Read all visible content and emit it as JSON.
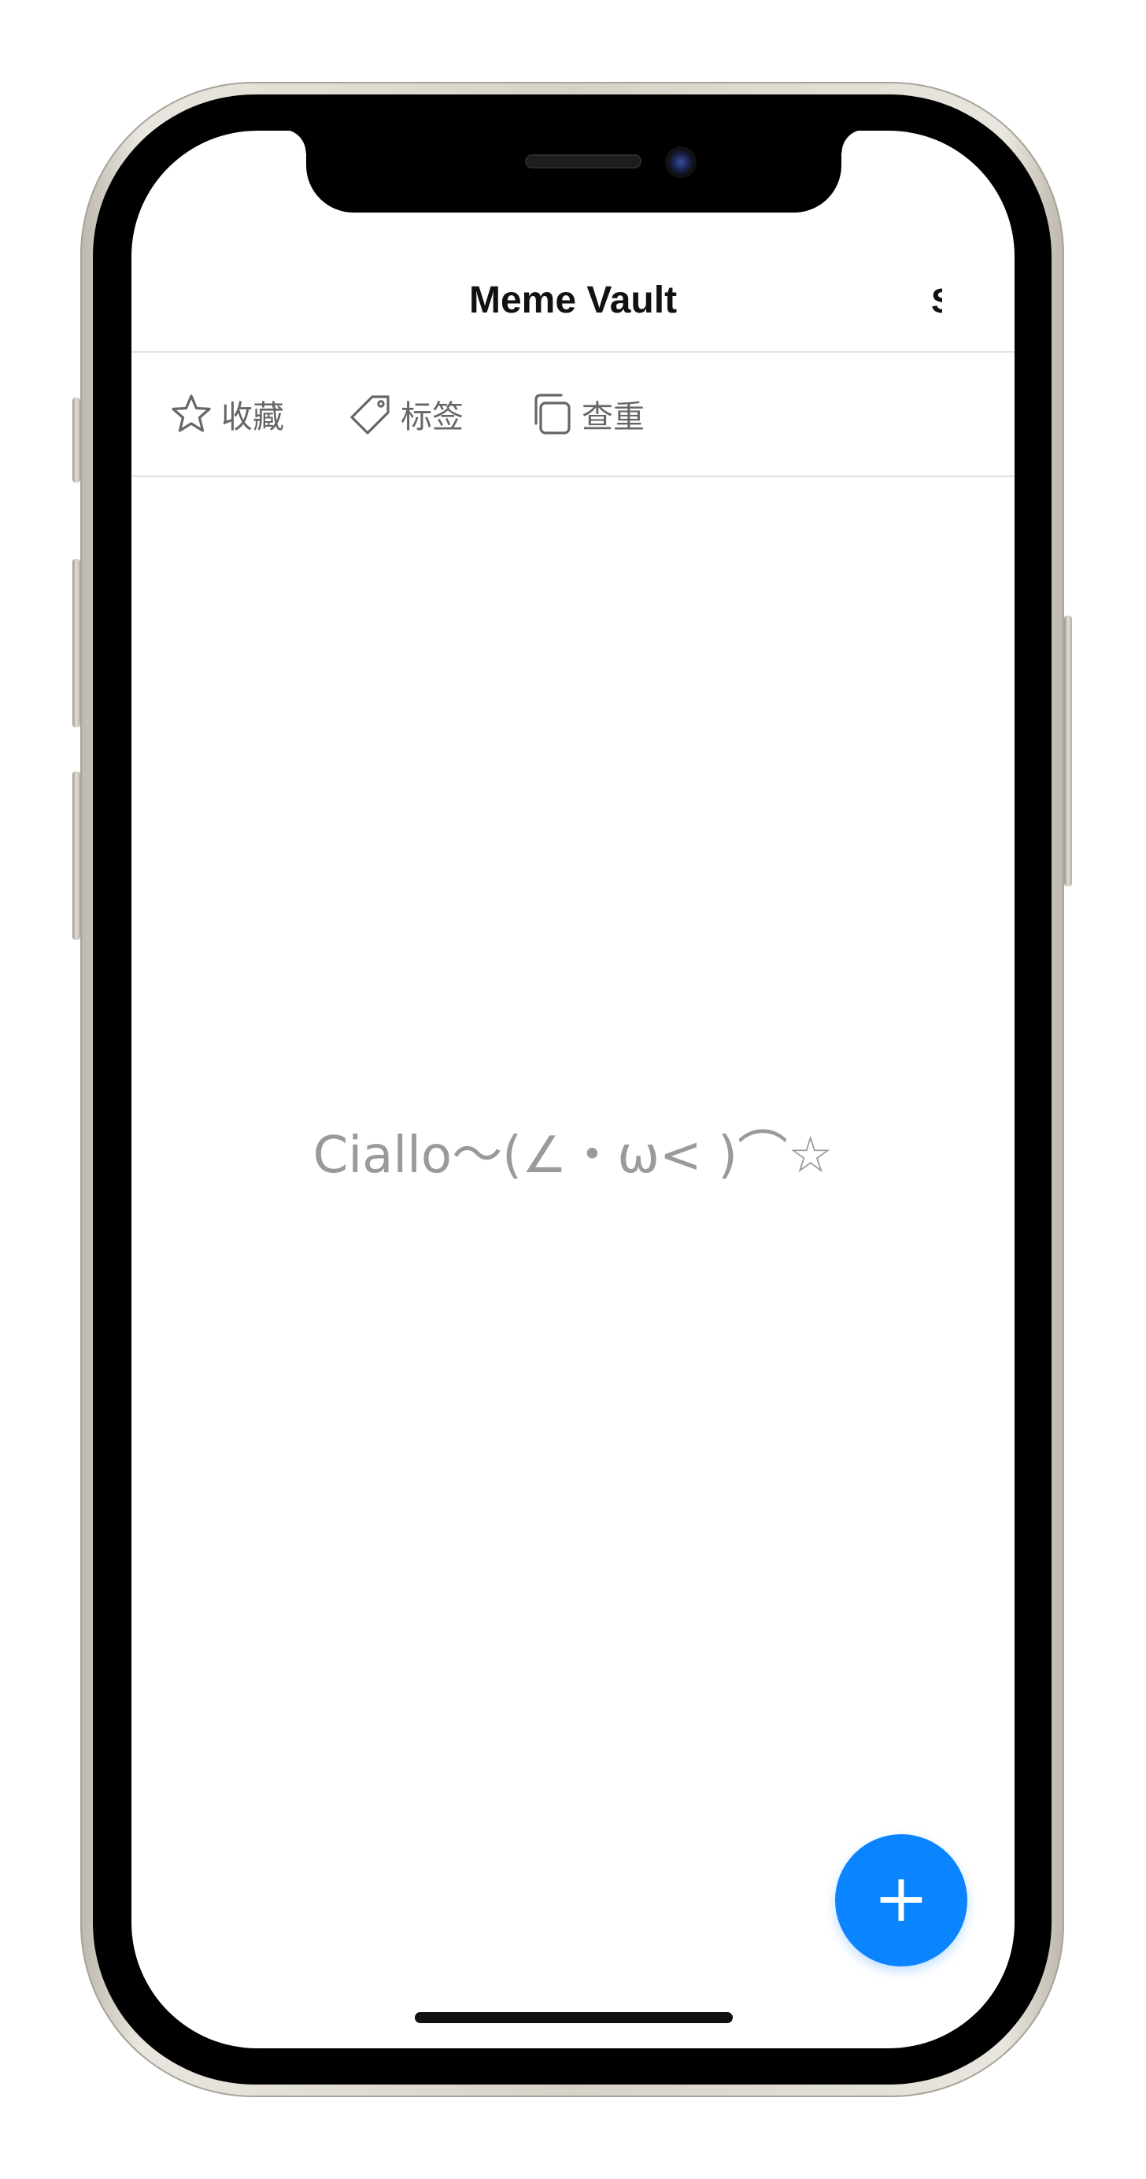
{
  "app": {
    "title": "Meme Vault",
    "nav_right_partial": "S"
  },
  "toolbar": {
    "items": [
      {
        "label": "收藏",
        "icon": "star-icon"
      },
      {
        "label": "标签",
        "icon": "tag-icon"
      },
      {
        "label": "查重",
        "icon": "duplicate-icon"
      }
    ]
  },
  "empty_state": {
    "text": "Ciallo～(∠・ω< )⌒☆"
  },
  "fab": {
    "label": "+",
    "color": "#0a84ff"
  },
  "colors": {
    "accent": "#0a84ff",
    "toolbar_text": "#666666",
    "empty_text": "#9a9a9a"
  }
}
